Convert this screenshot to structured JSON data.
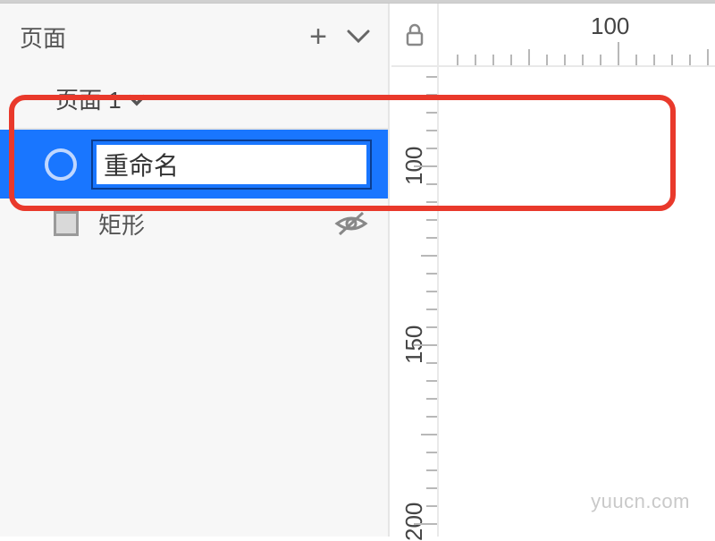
{
  "sidebar": {
    "title": "页面",
    "page_item_label": "页面 1"
  },
  "layers": {
    "selected": {
      "rename_value": "重命名"
    },
    "rect": {
      "label": "矩形"
    }
  },
  "ruler": {
    "h_label": "100",
    "v_labels": [
      "100",
      "150",
      "200"
    ]
  },
  "watermark": "yuucn.com"
}
